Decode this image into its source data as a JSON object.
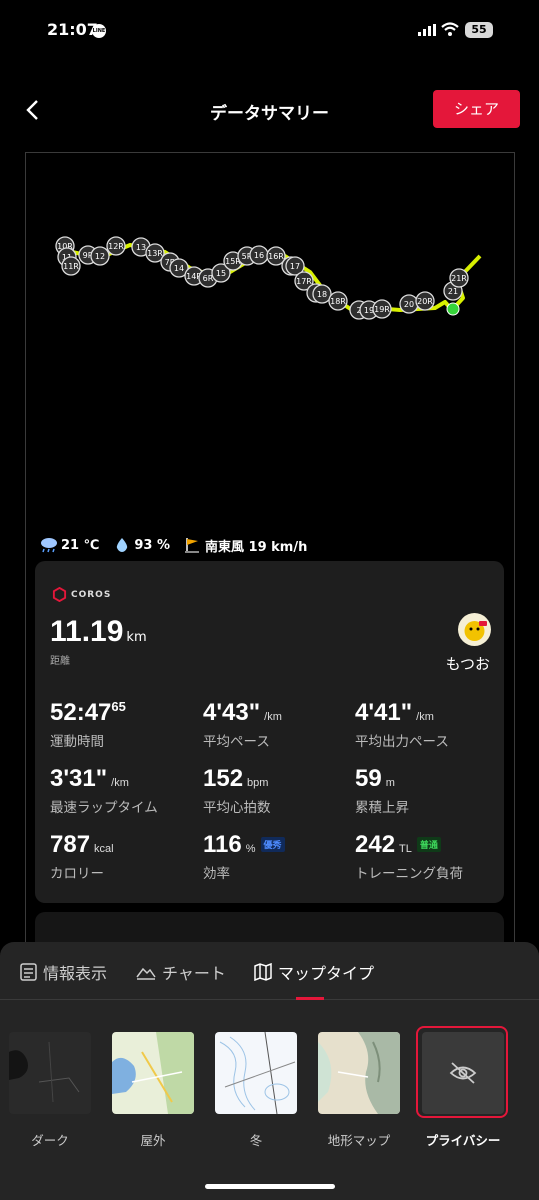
{
  "status_bar": {
    "time": "21:07",
    "notification_app": "LINE",
    "battery": "55"
  },
  "header": {
    "title": "データサマリー",
    "share_label": "シェア"
  },
  "map": {
    "route_color": "#d8f000",
    "end_marker_color": "#36d43a",
    "markers": [
      "10R",
      "11",
      "11R",
      "9R",
      "12",
      "12R",
      "13",
      "13R",
      "7R",
      "14",
      "14R",
      "6R",
      "15",
      "15R",
      "5R",
      "16",
      "16R",
      "4R",
      "17",
      "17R",
      "3",
      "18",
      "18R",
      "2",
      "19",
      "19R",
      "20",
      "20R",
      "21",
      "21R"
    ]
  },
  "weather": {
    "temperature": "21 ℃",
    "humidity": "93 %",
    "wind": "南東風 19 km/h"
  },
  "card": {
    "brand": "COROS",
    "distance_value": "11.19",
    "distance_unit": "km",
    "distance_label": "距離",
    "username": "もつお",
    "stats": [
      {
        "value": "52:47",
        "sup": "65",
        "unit": "",
        "label": "運動時間"
      },
      {
        "value": "4'43\"",
        "unit": "/km",
        "label": "平均ペース"
      },
      {
        "value": "4'41\"",
        "unit": "/km",
        "label": "平均出力ペース"
      },
      {
        "value": "3'31\"",
        "unit": "/km",
        "label": "最速ラップタイム"
      },
      {
        "value": "152",
        "unit": "bpm",
        "label": "平均心拍数"
      },
      {
        "value": "59",
        "unit": "m",
        "label": "累積上昇"
      },
      {
        "value": "787",
        "unit": "kcal",
        "label": "カロリー"
      },
      {
        "value": "116",
        "unit": "%",
        "badge": "優秀",
        "label": "効率"
      },
      {
        "value": "242",
        "unit": "TL",
        "badge": "普通",
        "label": "トレーニング負荷"
      }
    ]
  },
  "sheet": {
    "tabs": [
      {
        "label": "情報表示"
      },
      {
        "label": "チャート"
      },
      {
        "label": "マップタイプ"
      }
    ],
    "active_tab": "マップタイプ",
    "map_types": [
      {
        "label": "ダーク"
      },
      {
        "label": "屋外"
      },
      {
        "label": "冬"
      },
      {
        "label": "地形マップ"
      },
      {
        "label": "プライバシー"
      }
    ],
    "selected_map_type": "プライバシー"
  }
}
